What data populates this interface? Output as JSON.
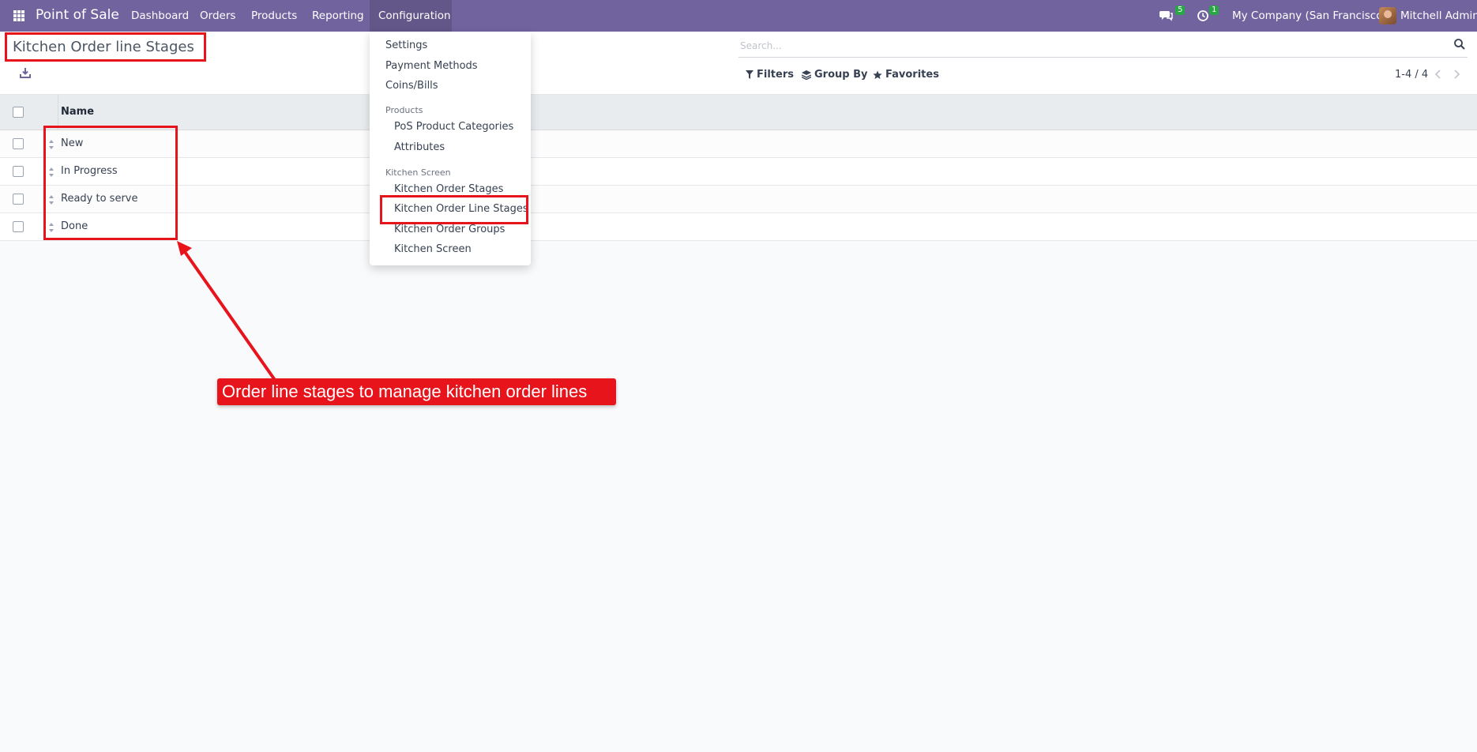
{
  "navbar": {
    "brand": "Point of Sale",
    "menu": [
      "Dashboard",
      "Orders",
      "Products",
      "Reporting",
      "Configuration"
    ],
    "messages_count": "5",
    "activities_count": "1",
    "company": "My Company (San Francisco)",
    "user": "Mitchell Admin"
  },
  "control_panel": {
    "title": "Kitchen Order line Stages",
    "search_placeholder": "Search...",
    "filters_label": "Filters",
    "group_by_label": "Group By",
    "favorites_label": "Favorites",
    "pager": "1-4 / 4"
  },
  "list": {
    "column_name": "Name",
    "rows": [
      "New",
      "In Progress",
      "Ready to serve",
      "Done"
    ]
  },
  "dropdown": {
    "items": [
      "Settings",
      "Payment Methods",
      "Coins/Bills"
    ],
    "products_header": "Products",
    "products_items": [
      "PoS Product Categories",
      "Attributes"
    ],
    "kitchen_header": "Kitchen Screen",
    "kitchen_items": [
      "Kitchen Order Stages",
      "Kitchen Order Line Stages",
      "Kitchen Order Groups",
      "Kitchen Screen"
    ]
  },
  "annotation": {
    "callout_text": "Order line stages to manage kitchen order lines",
    "color": "#e8141c"
  },
  "colors": {
    "navbar": "#71639e",
    "accent": "#71639e",
    "badge": "#28a745"
  }
}
